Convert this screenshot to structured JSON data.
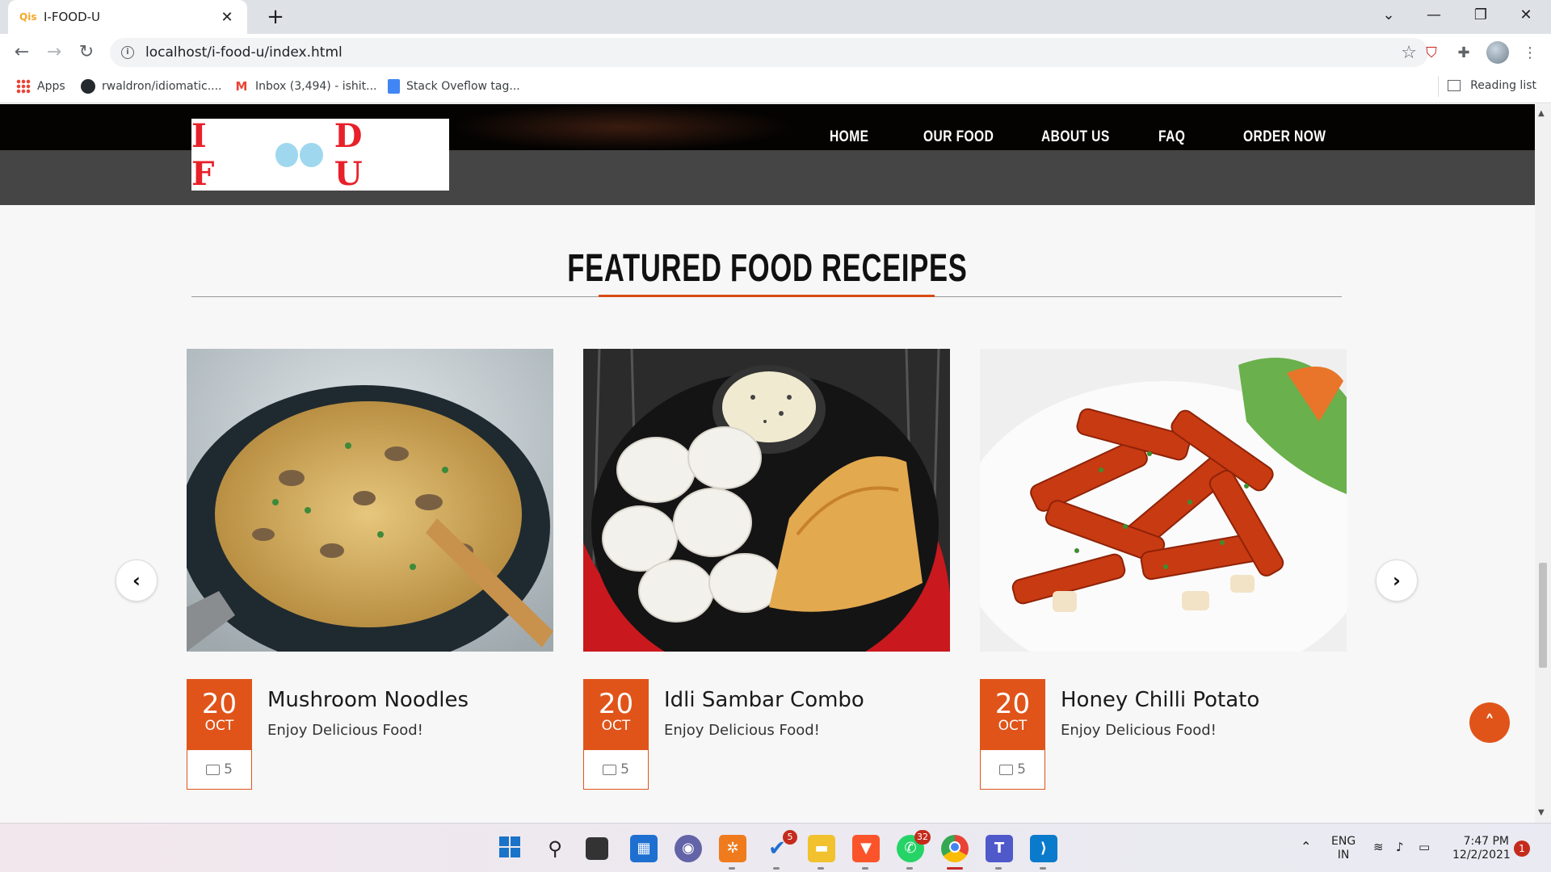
{
  "browser": {
    "tab_title": "I-FOOD-U",
    "favicon_text": "Qis",
    "url": "localhost/i-food-u/index.html",
    "bookmarks": [
      {
        "label": "Apps",
        "icon": "apps-grid-icon"
      },
      {
        "label": "rwaldron/idiomatic....",
        "icon": "github-icon"
      },
      {
        "label": "Inbox (3,494) - ishit...",
        "icon": "gmail-icon"
      },
      {
        "label": "Stack Oveflow tag...",
        "icon": "google-docs-icon"
      }
    ],
    "reading_list": "Reading list"
  },
  "site": {
    "logo_text_left": "I F",
    "logo_text_right": "D U",
    "nav": [
      "HOME",
      "OUR FOOD",
      "ABOUT US",
      "FAQ",
      "ORDER NOW"
    ],
    "section_title": "FEATURED FOOD RECEIPES",
    "accent_color": "#e0541a",
    "cards": [
      {
        "title": "Mushroom Noodles",
        "subtitle": "Enjoy Delicious Food!",
        "day": "20",
        "month": "OCT",
        "comments": "5"
      },
      {
        "title": "Idli Sambar Combo",
        "subtitle": "Enjoy Delicious Food!",
        "day": "20",
        "month": "OCT",
        "comments": "5"
      },
      {
        "title": "Honey Chilli Potato",
        "subtitle": "Enjoy Delicious Food!",
        "day": "20",
        "month": "OCT",
        "comments": "5"
      }
    ]
  },
  "taskbar": {
    "todo_badge": "5",
    "whatsapp_badge": "32",
    "lang_top": "ENG",
    "lang_bottom": "IN",
    "time": "7:47 PM",
    "date": "12/2/2021",
    "notifications": "1"
  }
}
